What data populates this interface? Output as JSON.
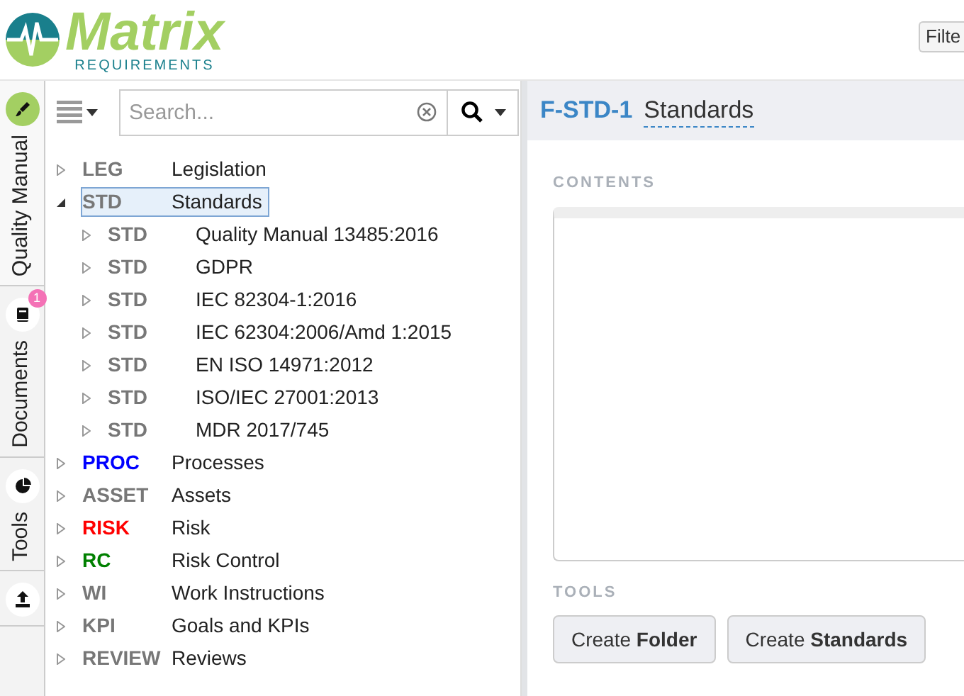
{
  "header": {
    "logo": {
      "name": "Matrix",
      "tagline": "REQUIREMENTS"
    },
    "filter_button": "Filte"
  },
  "side_tabs": [
    {
      "label": "Quality Manual",
      "selected": true
    },
    {
      "label": "Documents",
      "selected": false,
      "badge": "1"
    },
    {
      "label": "Tools",
      "selected": false
    },
    {
      "selected": false
    }
  ],
  "search": {
    "placeholder": "Search..."
  },
  "tree": [
    {
      "prefix": "LEG",
      "label": "Legislation",
      "color": "#777777",
      "expanded": false,
      "selected": false
    },
    {
      "prefix": "STD",
      "label": "Standards",
      "color": "#777777",
      "expanded": true,
      "selected": true,
      "children": [
        {
          "prefix": "STD",
          "label": "Quality Manual 13485:2016",
          "color": "#777777",
          "expanded": false,
          "selected": false
        },
        {
          "prefix": "STD",
          "label": "GDPR",
          "color": "#777777",
          "expanded": false,
          "selected": false
        },
        {
          "prefix": "STD",
          "label": "IEC 82304-1:2016",
          "color": "#777777",
          "expanded": false,
          "selected": false
        },
        {
          "prefix": "STD",
          "label": "IEC 62304:2006/Amd 1:2015",
          "color": "#777777",
          "expanded": false,
          "selected": false
        },
        {
          "prefix": "STD",
          "label": "EN ISO 14971:2012",
          "color": "#777777",
          "expanded": false,
          "selected": false
        },
        {
          "prefix": "STD",
          "label": "ISO/IEC 27001:2013",
          "color": "#777777",
          "expanded": false,
          "selected": false
        },
        {
          "prefix": "STD",
          "label": "MDR 2017/745",
          "color": "#777777",
          "expanded": false,
          "selected": false
        }
      ]
    },
    {
      "prefix": "PROC",
      "label": "Processes",
      "color": "#0000ff",
      "expanded": false,
      "selected": false
    },
    {
      "prefix": "ASSET",
      "label": "Assets",
      "color": "#777777",
      "expanded": false,
      "selected": false
    },
    {
      "prefix": "RISK",
      "label": "Risk",
      "color": "#ff0000",
      "expanded": false,
      "selected": false
    },
    {
      "prefix": "RC",
      "label": "Risk Control",
      "color": "#008000",
      "expanded": false,
      "selected": false
    },
    {
      "prefix": "WI",
      "label": "Work Instructions",
      "color": "#777777",
      "expanded": false,
      "selected": false
    },
    {
      "prefix": "KPI",
      "label": "Goals and KPIs",
      "color": "#777777",
      "expanded": false,
      "selected": false
    },
    {
      "prefix": "REVIEW",
      "label": "Reviews",
      "color": "#777777",
      "expanded": false,
      "selected": false
    }
  ],
  "detail": {
    "item_id": "F-STD-1",
    "title": "Standards",
    "contents_label": "CONTENTS",
    "tools_label": "TOOLS",
    "buttons": [
      "Create **Folder**",
      "Create **Standards**"
    ]
  }
}
